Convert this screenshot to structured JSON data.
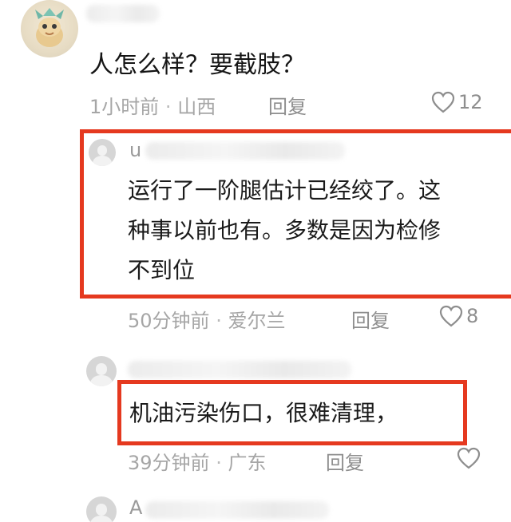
{
  "comment": {
    "text": "人怎么样？要截肢？",
    "time": "1小时前",
    "location": "山西",
    "reply_label": "回复",
    "likes": "12"
  },
  "replies": [
    {
      "username_initial": "u",
      "lines": [
        "运行了一阶腿估计已经绞了。这",
        "种事以前也有。多数是因为检修",
        "不到位"
      ],
      "time": "50分钟前",
      "location": "爱尔兰",
      "reply_label": "回复",
      "likes": "8"
    },
    {
      "text": "机油污染伤口，很难清理，",
      "time": "39分钟前",
      "location": "广东",
      "reply_label": "回复"
    },
    {
      "username_initial": "A"
    }
  ],
  "separator": "·",
  "colors": {
    "highlight_border": "#e5391f",
    "meta_text": "#a6a6a6"
  }
}
